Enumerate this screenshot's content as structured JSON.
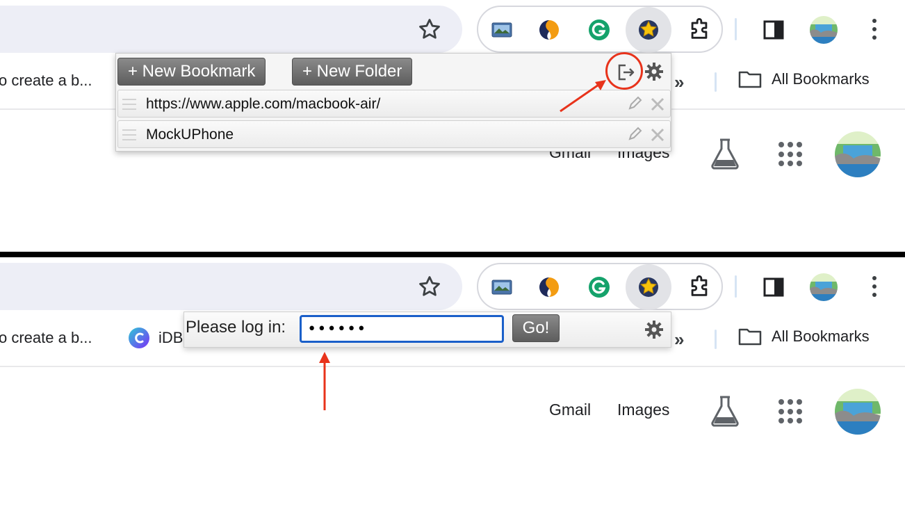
{
  "colors": {
    "accent_red": "#e8331b",
    "input_focus": "#1a5fc9",
    "omnibox_bg": "#edeef6"
  },
  "icons": {
    "star": "star-icon",
    "extensions": [
      "photo-extension-icon",
      "split-circle-extension-icon",
      "grammarly-icon",
      "bookmark-star-extension-icon",
      "puzzle-extensions-icon"
    ],
    "side_panel": "side-panel-icon",
    "menu": "kebab-menu-icon",
    "folder": "folder-icon",
    "labs": "flask-icon",
    "apps": "apps-grid-icon",
    "logout": "logout-icon",
    "settings": "gear-icon"
  },
  "top": {
    "bookmarks_bar": {
      "truncated_item": "o create a b...",
      "all_bookmarks": "All Bookmarks"
    },
    "google": {
      "gmail": "Gmail",
      "images": "Images"
    },
    "popup": {
      "new_bookmark_label": "+ New Bookmark",
      "new_folder_label": "+ New Folder",
      "bookmarks": [
        {
          "title": "https://www.apple.com/macbook-air/"
        },
        {
          "title": "MockUPhone"
        }
      ]
    }
  },
  "bottom": {
    "bookmarks_bar": {
      "truncated_item": "o create a b...",
      "idb_item": "iDB",
      "all_bookmarks": "All Bookmarks"
    },
    "google": {
      "gmail": "Gmail",
      "images": "Images"
    },
    "login": {
      "label": "Please log in:",
      "password_value": "••••••",
      "go_label": "Go!"
    }
  }
}
